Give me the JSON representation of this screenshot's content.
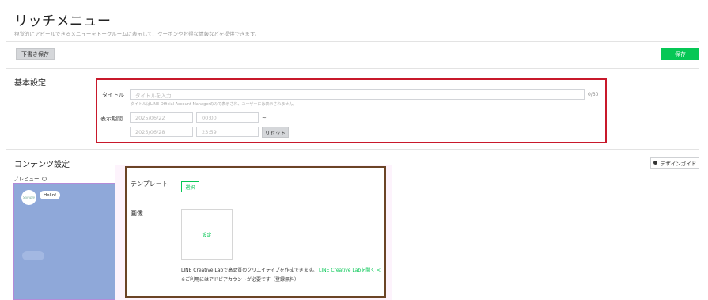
{
  "header": {
    "title": "リッチメニュー",
    "description": "視覚的にアピールできるメニューをトークルームに表示して、クーポンやお得な情報などを提供できます。"
  },
  "toolbar": {
    "draft_label": "下書き保存",
    "save_label": "保存"
  },
  "basic_settings": {
    "heading": "基本設定",
    "title_label": "タイトル",
    "title_placeholder": "タイトルを入力",
    "title_counter": "0/30",
    "title_hint": "タイトルはLINE Official Account Managerのみで表示され、ユーザーには表示されません。",
    "period_label": "表示期間",
    "start_date": "2025/06/22",
    "start_time": "00:00",
    "tilde": "~",
    "end_date": "2025/06/28",
    "end_time": "23:59",
    "reset_label": "リセット"
  },
  "content_settings": {
    "heading": "コンテンツ設定",
    "design_guide_label": "デザインガイド",
    "preview_label": "プレビュー",
    "help_glyph": "?",
    "preview": {
      "avatar_text": "Sample",
      "bubble_text": "Hello!"
    },
    "template_label": "テンプレート",
    "select_label": "選択",
    "image_label": "画像",
    "image_set_label": "設定",
    "creative_lab_text": "LINE Creative Labで高品質のクリエイティブを作成できます。",
    "creative_lab_link": "LINE Creative Labを開く",
    "link_arrow": "<",
    "note": "※ご利用にはアドビアカウントが必要です（登録無料）"
  },
  "colors": {
    "accent_green": "#06c755",
    "annotation_red": "#c8192b",
    "annotation_brown": "#6b4426",
    "preview_bg": "#8fa8d9"
  }
}
